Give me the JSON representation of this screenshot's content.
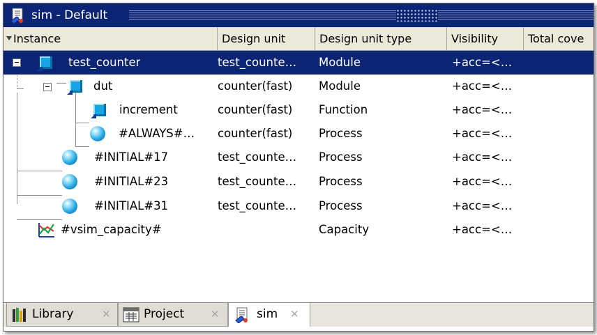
{
  "window": {
    "title": "sim - Default"
  },
  "columns": [
    {
      "label": "Instance"
    },
    {
      "label": "Design unit"
    },
    {
      "label": "Design unit type"
    },
    {
      "label": "Visibility"
    },
    {
      "label": "Total cove"
    }
  ],
  "rows": [
    {
      "instance": "test_counter",
      "design_unit": "test_counte…",
      "type": "Module",
      "visibility": "+acc=<…",
      "icon": "module-icon",
      "selected": true
    },
    {
      "instance": "dut",
      "design_unit": "counter(fast)",
      "type": "Module",
      "visibility": "+acc=<…",
      "icon": "module-icon"
    },
    {
      "instance": "increment",
      "design_unit": "counter(fast)",
      "type": "Function",
      "visibility": "+acc=<…",
      "icon": "function-icon"
    },
    {
      "instance": "#ALWAYS#…",
      "design_unit": "counter(fast)",
      "type": "Process",
      "visibility": "+acc=<…",
      "icon": "process-icon"
    },
    {
      "instance": "#INITIAL#17",
      "design_unit": "test_counte…",
      "type": "Process",
      "visibility": "+acc=<…",
      "icon": "process-icon"
    },
    {
      "instance": "#INITIAL#23",
      "design_unit": "test_counte…",
      "type": "Process",
      "visibility": "+acc=<…",
      "icon": "process-icon"
    },
    {
      "instance": "#INITIAL#31",
      "design_unit": "test_counte…",
      "type": "Process",
      "visibility": "+acc=<…",
      "icon": "process-icon"
    },
    {
      "instance": "#vsim_capacity#",
      "design_unit": "",
      "type": "Capacity",
      "visibility": "+acc=<…",
      "icon": "capacity-icon"
    }
  ],
  "tabs": [
    {
      "label": "Library",
      "close": "✕",
      "icon": "library-icon"
    },
    {
      "label": "Project",
      "close": "✕",
      "icon": "project-icon"
    },
    {
      "label": "sim",
      "close": "✕",
      "icon": "sim-icon",
      "active": true
    }
  ],
  "colors": {
    "titlebar": "#0b2473",
    "selection": "#0b2473",
    "header": "#ece9d8",
    "module_icon": "#16a6e6"
  }
}
